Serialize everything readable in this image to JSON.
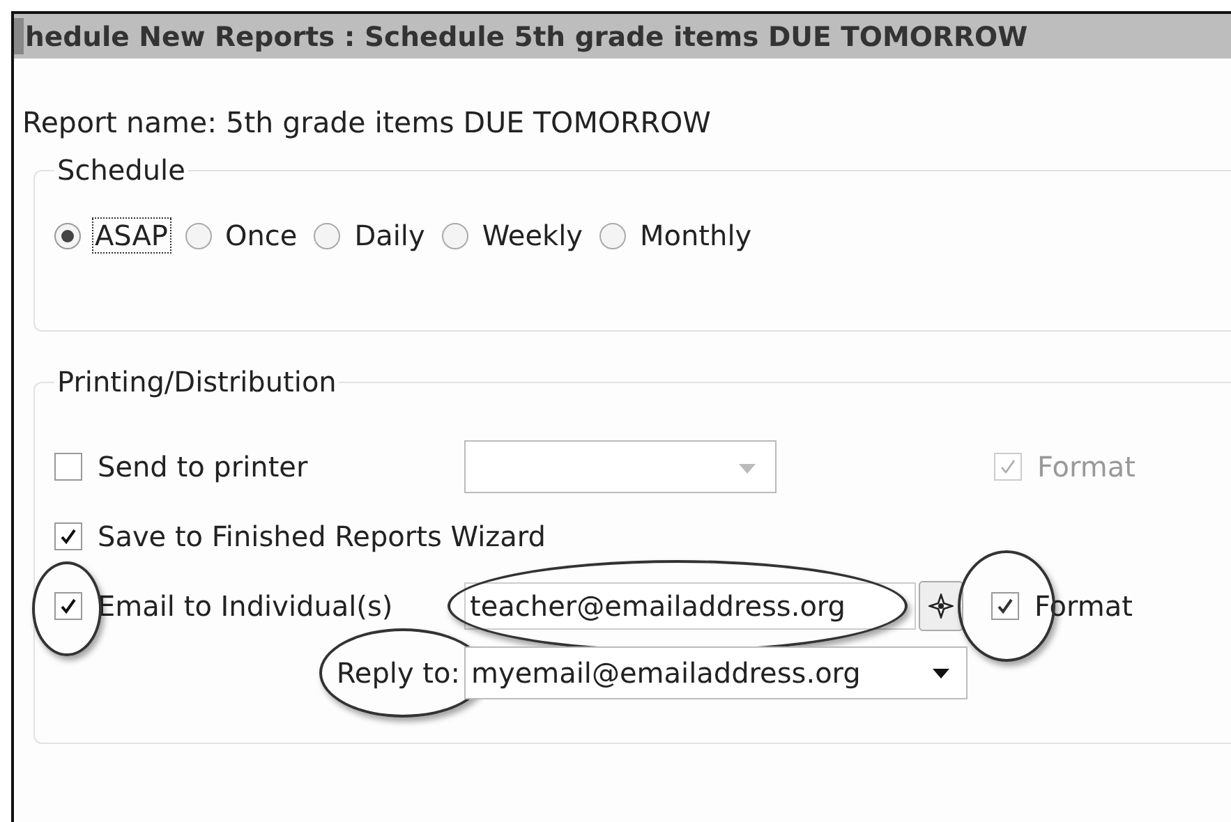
{
  "window": {
    "title": "hedule New Reports : Schedule 5th grade items DUE TOMORROW"
  },
  "report_name": "Report name: 5th grade items DUE TOMORROW",
  "schedule": {
    "legend": "Schedule",
    "options": [
      {
        "label": "ASAP",
        "selected": true
      },
      {
        "label": "Once",
        "selected": false
      },
      {
        "label": "Daily",
        "selected": false
      },
      {
        "label": "Weekly",
        "selected": false
      },
      {
        "label": "Monthly",
        "selected": false
      }
    ]
  },
  "distribution": {
    "legend": "Printing/Distribution",
    "rows": [
      {
        "kind": "printer",
        "label": "Send to printer",
        "checked": false,
        "format": {
          "label": "Format",
          "checked": true,
          "disabled": true
        }
      },
      {
        "kind": "plain",
        "label": "Save to Finished Reports Wizard",
        "checked": true
      },
      {
        "kind": "email",
        "label": "Email to Individual(s)",
        "checked": true,
        "circled": true,
        "value": "teacher@emailaddress.org",
        "value_circled": true,
        "format": {
          "label": "Format",
          "checked": true,
          "disabled": false,
          "circled": true
        }
      }
    ],
    "reply_to": {
      "label": "Reply to:",
      "circled": true,
      "value": "myemail@emailaddress.org"
    }
  }
}
